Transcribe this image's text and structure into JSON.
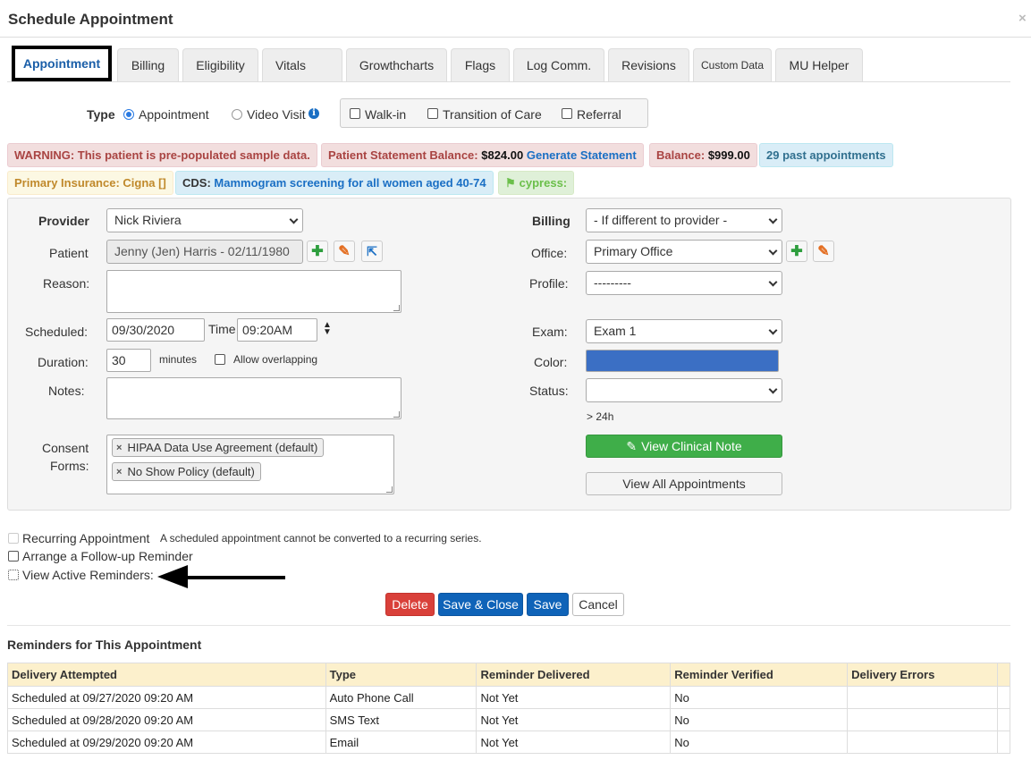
{
  "dialog": {
    "title": "Schedule Appointment",
    "close": "×"
  },
  "tabs": [
    {
      "label": "Appointment"
    },
    {
      "label": "Billing"
    },
    {
      "label": "Eligibility"
    },
    {
      "label": "Vitals"
    },
    {
      "label": "Growthcharts"
    },
    {
      "label": "Flags"
    },
    {
      "label": "Log Comm."
    },
    {
      "label": "Revisions"
    },
    {
      "label": "Custom Data"
    },
    {
      "label": "MU Helper"
    }
  ],
  "type_row": {
    "label": "Type",
    "appointment": "Appointment",
    "video_visit": "Video Visit",
    "walk_in": "Walk-in",
    "transition_of_care": "Transition of Care",
    "referral": "Referral"
  },
  "badges": {
    "warning": "WARNING: This patient is pre-populated sample data.",
    "statement_label": "Patient Statement Balance:",
    "statement_value": "$824.00",
    "statement_link": "Generate Statement",
    "balance_label": "Balance:",
    "balance_value": "$999.00",
    "past_appts": "29 past appointments",
    "insurance": "Primary Insurance: Cigna []",
    "cds_label": "CDS:",
    "cds_value": "Mammogram screening for all women aged 40-74",
    "flag": "cypress:"
  },
  "form": {
    "provider_label": "Provider",
    "provider_value": "Nick Riviera",
    "patient_label": "Patient",
    "patient_value": "Jenny (Jen) Harris - 02/11/1980",
    "reason_label": "Reason:",
    "scheduled_label": "Scheduled:",
    "scheduled_value": "09/30/2020",
    "time_label": "Time",
    "time_value": "09:20AM",
    "duration_label": "Duration:",
    "duration_value": "30",
    "minutes_label": "minutes",
    "allow_overlap_label": "Allow overlapping",
    "notes_label": "Notes:",
    "consent_label_1": "Consent",
    "consent_label_2": "Forms:",
    "consent_tags": [
      "HIPAA Data Use Agreement (default)",
      "No Show Policy (default)"
    ],
    "billing_label": "Billing",
    "billing_value": "- If different to provider -",
    "office_label": "Office:",
    "office_value": "Primary Office",
    "profile_label": "Profile:",
    "profile_value": "---------",
    "exam_label": "Exam:",
    "exam_value": "Exam 1",
    "color_label": "Color:",
    "color_value": "#3b6fc4",
    "status_label": "Status:",
    "status_value": "",
    "status_hint": "> 24h",
    "view_note_btn": "View Clinical Note",
    "view_all_btn": "View All Appointments"
  },
  "options": {
    "recurring": "Recurring Appointment",
    "recurring_note": "A scheduled appointment cannot be converted to a recurring series.",
    "followup": "Arrange a Follow-up Reminder",
    "active_reminders": "View Active Reminders:"
  },
  "actions": {
    "delete": "Delete",
    "save_close": "Save & Close",
    "save": "Save",
    "cancel": "Cancel"
  },
  "reminders": {
    "heading": "Reminders for This Appointment",
    "columns": [
      "Delivery Attempted",
      "Type",
      "Reminder Delivered",
      "Reminder Verified",
      "Delivery Errors"
    ],
    "rows": [
      [
        "Scheduled at 09/27/2020 09:20 AM",
        "Auto Phone Call",
        "Not Yet",
        "No",
        ""
      ],
      [
        "Scheduled at 09/28/2020 09:20 AM",
        "SMS Text",
        "Not Yet",
        "No",
        ""
      ],
      [
        "Scheduled at 09/29/2020 09:20 AM",
        "Email",
        "Not Yet",
        "No",
        ""
      ]
    ]
  }
}
